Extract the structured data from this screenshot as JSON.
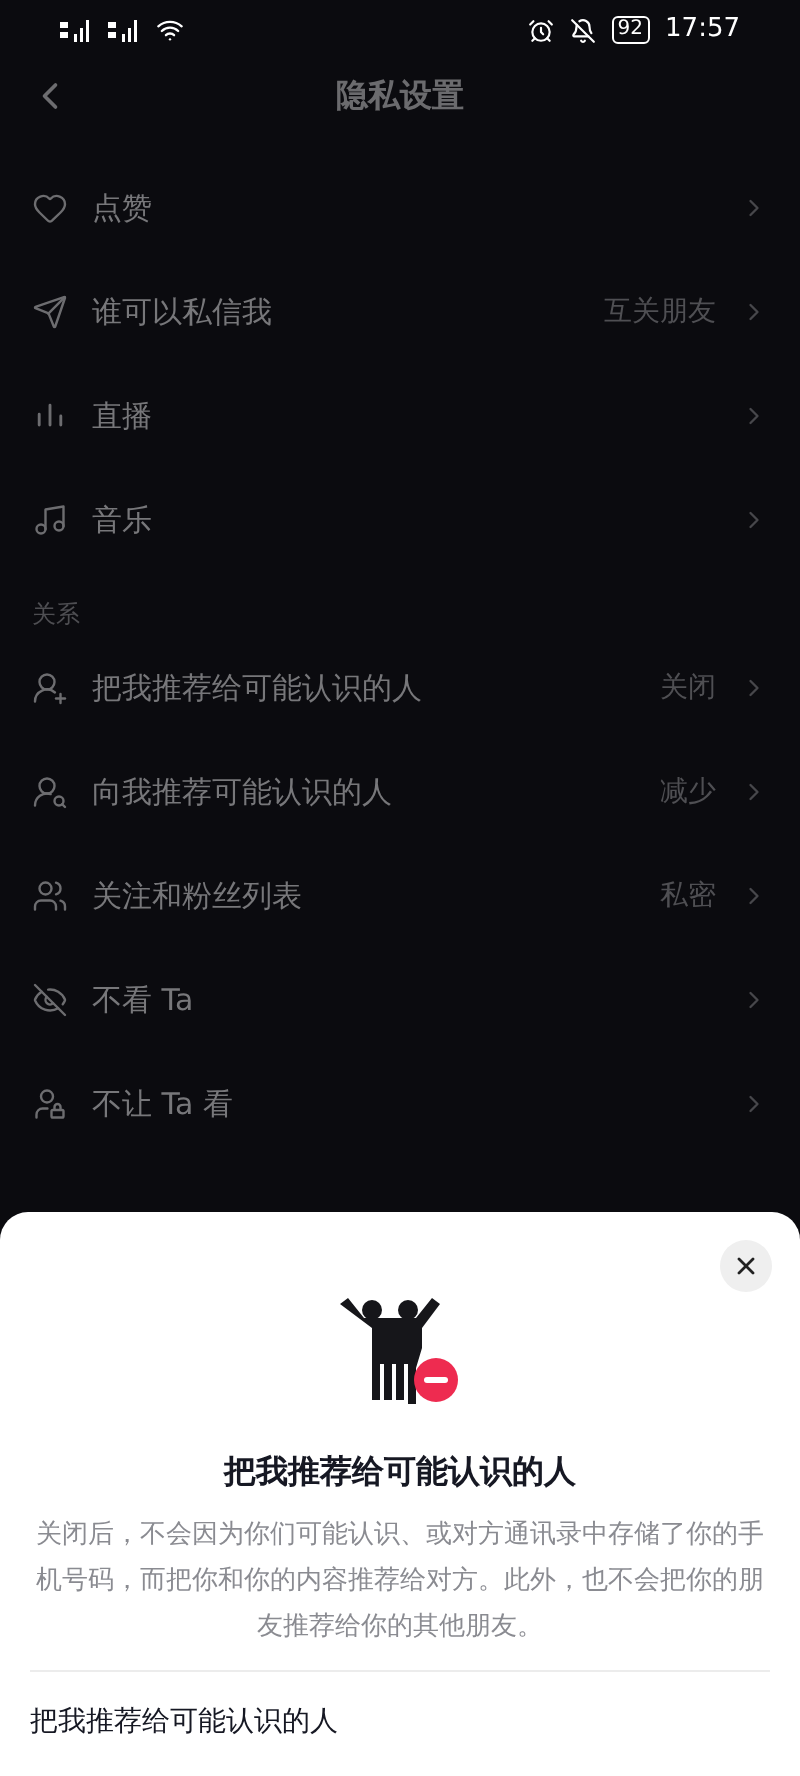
{
  "status_bar": {
    "battery": "92",
    "time": "17:57"
  },
  "header": {
    "title": "隐私设置"
  },
  "sections": [
    {
      "items": [
        {
          "label": "点赞"
        },
        {
          "label": "谁可以私信我",
          "value": "互关朋友"
        },
        {
          "label": "直播"
        },
        {
          "label": "音乐"
        }
      ]
    },
    {
      "heading": "关系",
      "items": [
        {
          "label": "把我推荐给可能认识的人",
          "value": "关闭"
        },
        {
          "label": "向我推荐可能认识的人",
          "value": "减少"
        },
        {
          "label": "关注和粉丝列表",
          "value": "私密"
        },
        {
          "label": "不看 Ta"
        },
        {
          "label": "不让 Ta 看"
        }
      ]
    }
  ],
  "sheet": {
    "title": "把我推荐给可能认识的人",
    "description": "关闭后，不会因为你们可能认识、或对方通讯录中存储了你的手机号码，而把你和你的内容推荐给对方。此外，也不会把你的朋友推荐给你的其他朋友。",
    "option": {
      "label": "把我推荐给可能认识的人"
    }
  }
}
